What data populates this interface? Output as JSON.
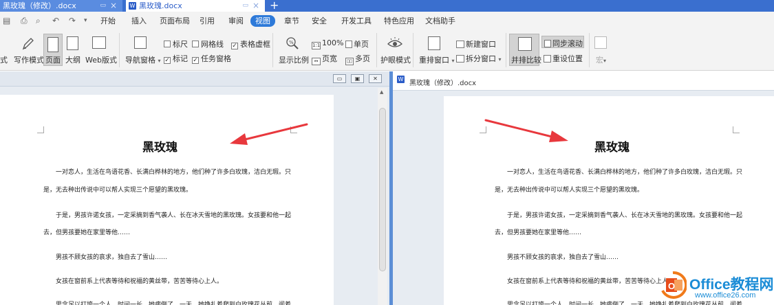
{
  "tabs": [
    {
      "label": "黑玫瑰（修改）.docx"
    },
    {
      "label": "黑玫瑰.docx"
    }
  ],
  "tab_add_label": "+",
  "menu": [
    "开始",
    "插入",
    "页面布局",
    "引用",
    "审阅",
    "视图",
    "章节",
    "安全",
    "开发工具",
    "特色应用",
    "文档助手"
  ],
  "ribbon": {
    "mode_partial": "式",
    "write_mode": "写作模式",
    "page": "页面",
    "outline": "大纲",
    "web": "Web版式",
    "nav_pane": "导航窗格",
    "ruler": "标尺",
    "gridlines": "网格线",
    "table_gridlines": "表格虚框",
    "markup": "标记",
    "task_pane": "任务窗格",
    "zoom": "显示比例",
    "zoom_100": "100%",
    "page_width": "页宽",
    "single_page": "单页",
    "multi_page": "多页",
    "eye_mode": "护眼模式",
    "arrange": "重排窗口",
    "new_window": "新建窗口",
    "split_window": "拆分窗口",
    "side_by_side": "并排比较",
    "sync_scroll": "同步滚动",
    "reset_position": "重设位置",
    "macro": "宏"
  },
  "right_window_title": "黑玫瑰（修改）.docx",
  "document": {
    "title": "黑玫瑰",
    "lines": [
      "一对恋人，生活在鸟语花香、长满白桦林的地方，他们种了许多白玫瑰，洁白无瑕。只",
      "是，无去种出传说中可以帮人实现三个愿望的黑玫瑰。",
      "于是，男孩许诺女孩，一定采摘到香气袭人、长在冰天雪地的黑玫瑰。女孩要和他一起",
      "去，但男孩要她在家里等他……",
      "男孩不顾女孩的哀求，独自去了雪山……",
      "女孩在窗前系上代表等待和祝福的黄丝带，苦苦等待心上人。",
      "思念足以打垮一个人，时间一长，她病倒了。一天，她挣扎着爬到白玫瑰花丛前，闻着"
    ]
  },
  "watermark": {
    "text": "Office教程网",
    "url": "www.office26.com"
  },
  "colors": {
    "tab_bar": "#3a6fcf",
    "divider": "#5c8ed6",
    "arrow": "#e8383d",
    "watermark_blue": "#1b8cd6",
    "watermark_orange": "#f07a1a"
  }
}
